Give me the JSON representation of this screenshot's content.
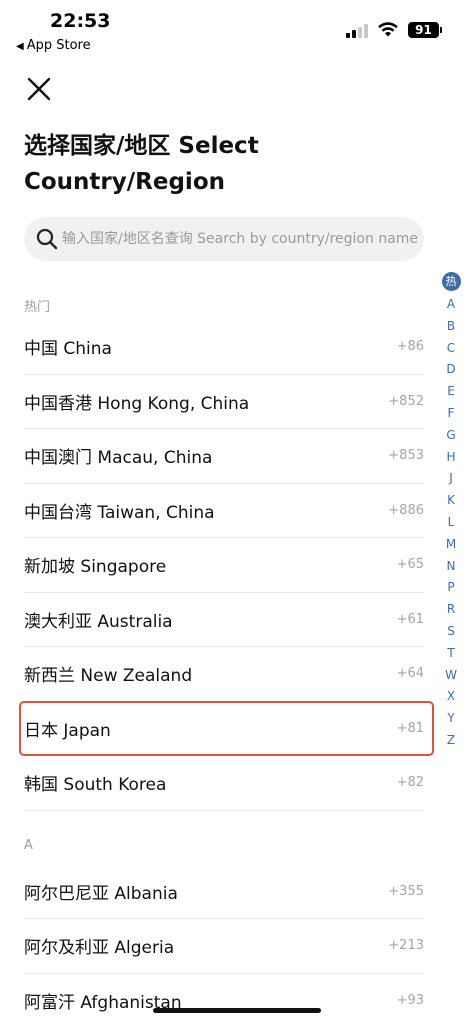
{
  "status": {
    "time": "22:53",
    "back_app": "App Store",
    "battery": "91"
  },
  "page": {
    "title": "选择国家/地区 Select Country/Region"
  },
  "search": {
    "placeholder": "输入国家/地区名查询 Search by country/region name"
  },
  "sections": {
    "hot": {
      "header": "热门",
      "items": [
        {
          "name": "中国 China",
          "code": "+86"
        },
        {
          "name": "中国香港 Hong Kong, China",
          "code": "+852"
        },
        {
          "name": "中国澳门 Macau, China",
          "code": "+853"
        },
        {
          "name": "中国台湾 Taiwan, China",
          "code": "+886"
        },
        {
          "name": "新加坡 Singapore",
          "code": "+65"
        },
        {
          "name": "澳大利亚 Australia",
          "code": "+61"
        },
        {
          "name": "新西兰 New Zealand",
          "code": "+64"
        },
        {
          "name": "日本 Japan",
          "code": "+81"
        },
        {
          "name": "韩国 South Korea",
          "code": "+82"
        }
      ]
    },
    "a": {
      "header": "A",
      "items": [
        {
          "name": "阿尔巴尼亚 Albania",
          "code": "+355"
        },
        {
          "name": "阿尔及利亚 Algeria",
          "code": "+213"
        },
        {
          "name": "阿富汗 Afghanistan",
          "code": "+93"
        }
      ]
    }
  },
  "index_bar": {
    "hot": "热",
    "letters": [
      "A",
      "B",
      "C",
      "D",
      "E",
      "F",
      "G",
      "H",
      "J",
      "K",
      "L",
      "M",
      "N",
      "P",
      "R",
      "S",
      "T",
      "W",
      "X",
      "Y",
      "Z"
    ]
  },
  "colors": {
    "accent": "#3c6ea6",
    "highlight": "#e2533b",
    "secondary_text": "#a6a6a6"
  }
}
